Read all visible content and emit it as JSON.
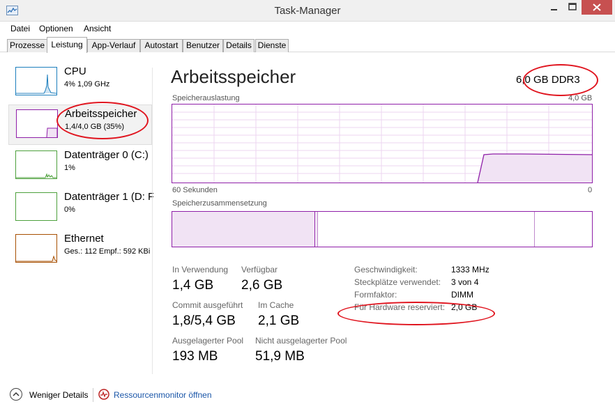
{
  "window": {
    "title": "Task-Manager"
  },
  "menu": [
    "Datei",
    "Optionen",
    "Ansicht"
  ],
  "tabs": [
    {
      "label": "Prozesse",
      "active": false
    },
    {
      "label": "Leistung",
      "active": true
    },
    {
      "label": "App-Verlauf",
      "active": false
    },
    {
      "label": "Autostart",
      "active": false
    },
    {
      "label": "Benutzer",
      "active": false
    },
    {
      "label": "Details",
      "active": false
    },
    {
      "label": "Dienste",
      "active": false
    }
  ],
  "sidebar": {
    "items": [
      {
        "name": "CPU",
        "sub": "4%  1,09 GHz",
        "color": "#1c7ebd",
        "selected": false
      },
      {
        "name": "Arbeitsspeicher",
        "sub": "1,4/4,0 GB (35%)",
        "color": "#8f1fa8",
        "selected": true
      },
      {
        "name": "Datenträger 0 (C:)",
        "sub": "1%",
        "color": "#4da03c",
        "selected": false
      },
      {
        "name": "Datenträger 1 (D: F",
        "sub": "0%",
        "color": "#4da03c",
        "selected": false
      },
      {
        "name": "Ethernet",
        "sub": "Ges.: 112  Empf.: 592 KBi",
        "color": "#a74f01",
        "selected": false
      }
    ]
  },
  "main": {
    "title": "Arbeitsspeicher",
    "spec": "6,0 GB DDR3",
    "usage_chart": {
      "label": "Speicherauslastung",
      "max_label": "4,0 GB",
      "x_left_label": "60 Sekunden",
      "x_right_label": "0"
    },
    "composition_label": "Speicherzusammensetzung",
    "stats": [
      {
        "label": "In Verwendung",
        "value": "1,4 GB"
      },
      {
        "label": "Verfügbar",
        "value": "2,6 GB"
      },
      {
        "label": "Commit ausgeführt",
        "value": "1,8/5,4 GB"
      },
      {
        "label": "Im Cache",
        "value": "2,1 GB"
      },
      {
        "label": "Ausgelagerter Pool",
        "value": "193 MB"
      },
      {
        "label": "Nicht ausgelagerter Pool",
        "value": "51,9 MB"
      }
    ],
    "properties": [
      {
        "label": "Geschwindigkeit:",
        "value": "1333 MHz"
      },
      {
        "label": "Steckplätze verwendet:",
        "value": "3 von 4"
      },
      {
        "label": "Formfaktor:",
        "value": "DIMM"
      },
      {
        "label": "Für Hardware reserviert:",
        "value": "2,0 GB"
      }
    ]
  },
  "footer": {
    "fewer_details": "Weniger Details",
    "resource_monitor": "Ressourcenmonitor öffnen"
  },
  "colors": {
    "memory": "#8f1fa8",
    "annotation": "#e0141e"
  }
}
